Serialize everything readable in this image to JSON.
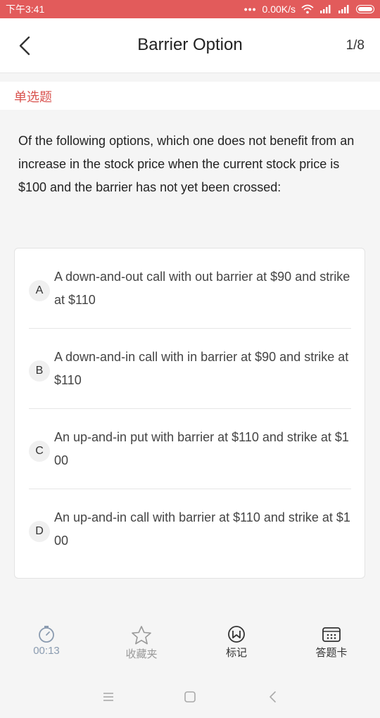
{
  "status_bar": {
    "time": "下午3:41",
    "speed": "0.00K/s",
    "wifi_icon": "wifi-icon",
    "signal_icon": "signal-icon",
    "battery_icon": "battery-icon"
  },
  "header": {
    "title": "Barrier Option",
    "counter": "1/8",
    "back_icon": "chevron-left-icon"
  },
  "question": {
    "type": "单选题",
    "text": "Of the following options, which one does not benefit from an increase in the stock price when the current stock price is $100 and the barrier has not yet been crossed:",
    "options": [
      {
        "letter": "A",
        "text": "A down-and-out call with out barrier at $90 and strike at $110"
      },
      {
        "letter": "B",
        "text": "A down-and-in call with in barrier at $90 and strike at $110"
      },
      {
        "letter": "C",
        "text": "An up-and-in put with barrier at $110 and strike at $100"
      },
      {
        "letter": "D",
        "text": "An up-and-in call with barrier at $110 and strike at $100"
      }
    ]
  },
  "toolbar": {
    "timer": "00:13",
    "favorite": "收藏夹",
    "mark": "标记",
    "answer_card": "答题卡"
  },
  "colors": {
    "accent": "#e25b5b",
    "type_label": "#d9534f",
    "timer": "#8a9bb0"
  }
}
